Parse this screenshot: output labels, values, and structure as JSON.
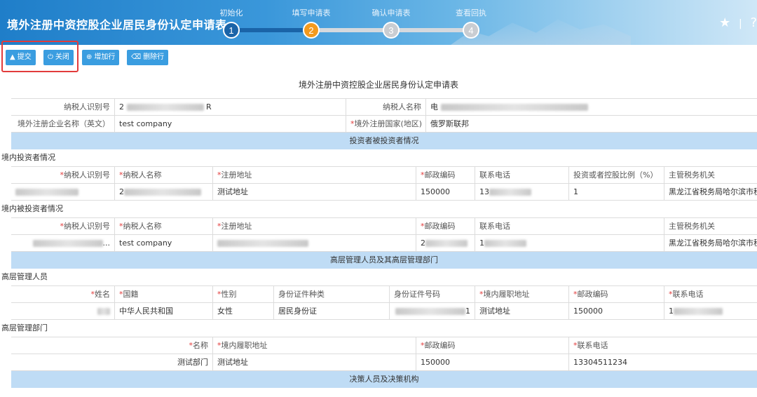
{
  "header": {
    "title": "境外注册中资控股企业居民身份认定申请表",
    "steps": [
      {
        "label": "初始化",
        "num": "1",
        "state": "done"
      },
      {
        "label": "填写申请表",
        "num": "2",
        "state": "current"
      },
      {
        "label": "确认申请表",
        "num": "3",
        "state": "todo"
      },
      {
        "label": "查看回执",
        "num": "4",
        "state": "todo"
      }
    ],
    "star_icon": "★",
    "divider": "|",
    "help_icon": "?"
  },
  "toolbar": {
    "submit_label": "提交",
    "close_label": "关闭",
    "add_row_label": "增加行",
    "delete_row_label": "删除行"
  },
  "form": {
    "title": "境外注册中资控股企业居民身份认定申请表",
    "basic": {
      "taxpayer_id_label": "纳税人识别号",
      "taxpayer_id_value": "2",
      "taxpayer_id_tail": "R",
      "taxpayer_name_label": "纳税人名称",
      "taxpayer_name_value": "电",
      "foreign_name_label": "境外注册企业名称（英文）",
      "foreign_name_value": "test company",
      "country_label": "境外注册国家(地区)",
      "country_value": "俄罗斯联邦"
    },
    "section_investor": "投资者被投资者情况",
    "domestic_investor": {
      "title": "境内投资者情况",
      "headers": [
        "纳税人识别号",
        "纳税人名称",
        "注册地址",
        "邮政编码",
        "联系电话",
        "投资或者控股比例（%）",
        "主管税务机关"
      ],
      "row": {
        "id": "",
        "name": "2",
        "address": "测试地址",
        "postcode": "150000",
        "phone": "13",
        "ratio": "1",
        "authority": "黑龙江省税务局哈尔滨市税"
      }
    },
    "domestic_invested": {
      "title": "境内被投资者情况",
      "headers": [
        "纳税人识别号",
        "纳税人名称",
        "注册地址",
        "邮政编码",
        "联系电话",
        "主管税务机关"
      ],
      "row": {
        "id": "...",
        "name": "test company",
        "address": "",
        "postcode": "2",
        "phone": "1",
        "authority": "黑龙江省税务局哈尔滨市税"
      }
    },
    "section_management": "高层管理人员及其高层管理部门",
    "managers": {
      "title": "高层管理人员",
      "headers": [
        "姓名",
        "国籍",
        "性别",
        "身份证件种类",
        "身份证件号码",
        "境内履职地址",
        "邮政编码",
        "联系电话"
      ],
      "row": {
        "name": "",
        "nationality": "中华人民共和国",
        "gender": "女性",
        "id_type": "居民身份证",
        "id_no": "1",
        "address": "测试地址",
        "postcode": "150000",
        "phone": "1"
      }
    },
    "departments": {
      "title": "高层管理部门",
      "headers": [
        "名称",
        "境内履职地址",
        "邮政编码",
        "联系电话"
      ],
      "row": {
        "name": "测试部门",
        "address": "测试地址",
        "postcode": "150000",
        "phone": "13304511234"
      }
    },
    "section_decision": "决策人员及决策机构"
  },
  "colors": {
    "accent": "#3a9de0",
    "step_current": "#f39a1e",
    "step_done": "#1a64a8",
    "section_bg": "#bfdcf5",
    "required": "#e23b3b"
  }
}
